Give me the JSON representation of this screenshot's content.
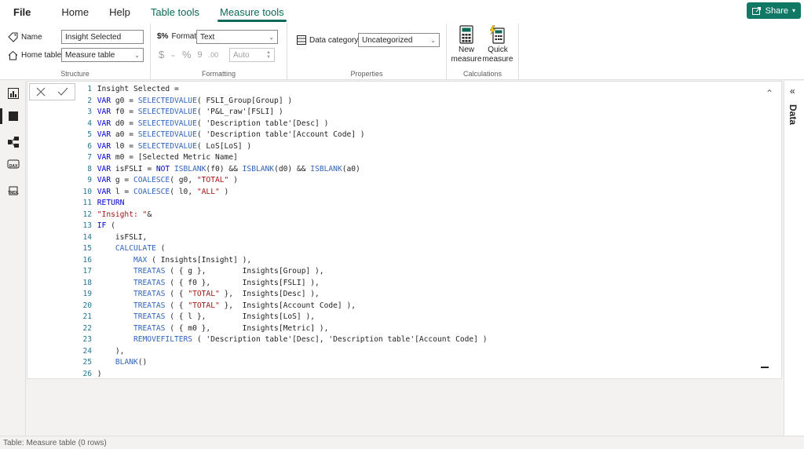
{
  "menu": {
    "tabs": [
      {
        "label": "File"
      },
      {
        "label": "Home"
      },
      {
        "label": "Help"
      },
      {
        "label": "Table tools"
      },
      {
        "label": "Measure tools"
      }
    ],
    "share_label": "Share"
  },
  "ribbon": {
    "structure": {
      "name_label": "Name",
      "name_value": "Insight Selected",
      "home_table_label": "Home table",
      "home_table_value": "Measure table",
      "group_label": "Structure"
    },
    "formatting": {
      "format_label": "Format",
      "format_value": "Text",
      "currency_symbol": "$",
      "percent_symbol": "%",
      "comma_symbol": "9",
      "decimals_symbol": ".00",
      "auto_value": "Auto",
      "group_label": "Formatting"
    },
    "properties": {
      "data_category_label": "Data category",
      "data_category_value": "Uncategorized",
      "group_label": "Properties"
    },
    "calculations": {
      "new_measure_line1": "New",
      "new_measure_line2": "measure",
      "quick_measure_line1": "Quick",
      "quick_measure_line2": "measure",
      "group_label": "Calculations"
    }
  },
  "left_rail": {
    "icons": [
      "report-view-icon",
      "table-view-icon",
      "model-view-icon",
      "dax-query-icon",
      "tmdl-view-icon"
    ],
    "dax_label": "DAX",
    "tmdl_label": "TMDL"
  },
  "editor": {
    "lines": [
      {
        "n": "1",
        "text": "Insight Selected ="
      },
      {
        "n": "2",
        "text": "VAR g0 = SELECTEDVALUE( FSLI_Group[Group] )"
      },
      {
        "n": "3",
        "text": "VAR f0 = SELECTEDVALUE( 'P&L_raw'[FSLI] )"
      },
      {
        "n": "4",
        "text": "VAR d0 = SELECTEDVALUE( 'Description table'[Desc] )"
      },
      {
        "n": "5",
        "text": "VAR a0 = SELECTEDVALUE( 'Description table'[Account Code] )"
      },
      {
        "n": "6",
        "text": "VAR l0 = SELECTEDVALUE( LoS[LoS] )"
      },
      {
        "n": "7",
        "text": "VAR m0 = [Selected Metric Name]"
      },
      {
        "n": "8",
        "text": "VAR isFSLI = NOT ISBLANK(f0) && ISBLANK(d0) && ISBLANK(a0)"
      },
      {
        "n": "9",
        "text": "VAR g = COALESCE( g0, \"TOTAL\" )"
      },
      {
        "n": "10",
        "text": "VAR l = COALESCE( l0, \"ALL\" )"
      },
      {
        "n": "11",
        "text": "RETURN"
      },
      {
        "n": "12",
        "text": "\"Insight: \"&"
      },
      {
        "n": "13",
        "text": "IF ("
      },
      {
        "n": "14",
        "text": "    isFSLI,"
      },
      {
        "n": "15",
        "text": "    CALCULATE ("
      },
      {
        "n": "16",
        "text": "        MAX ( Insights[Insight] ),"
      },
      {
        "n": "17",
        "text": "        TREATAS ( { g },        Insights[Group] ),"
      },
      {
        "n": "18",
        "text": "        TREATAS ( { f0 },       Insights[FSLI] ),"
      },
      {
        "n": "19",
        "text": "        TREATAS ( { \"TOTAL\" },  Insights[Desc] ),"
      },
      {
        "n": "20",
        "text": "        TREATAS ( { \"TOTAL\" },  Insights[Account Code] ),"
      },
      {
        "n": "21",
        "text": "        TREATAS ( { l },        Insights[LoS] ),"
      },
      {
        "n": "22",
        "text": "        TREATAS ( { m0 },       Insights[Metric] ),"
      },
      {
        "n": "23",
        "text": "        REMOVEFILTERS ( 'Description table'[Desc], 'Description table'[Account Code] )"
      },
      {
        "n": "24",
        "text": "    ),"
      },
      {
        "n": "25",
        "text": "    BLANK()"
      },
      {
        "n": "26",
        "text": ")"
      }
    ]
  },
  "data_pane": {
    "label": "Data"
  },
  "status": {
    "text": "Table: Measure table (0 rows)"
  },
  "colors": {
    "accent": "#117865",
    "tab_active": "#0b6a58",
    "keyword": "#0000d0",
    "string": "#a31515",
    "line_number": "#237893"
  }
}
